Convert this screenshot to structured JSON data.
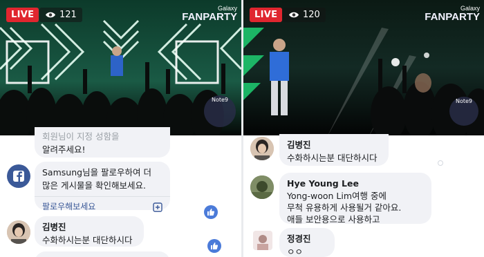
{
  "left": {
    "live_label": "LIVE",
    "viewer_count": "121",
    "logo_line1": "Galaxy",
    "logo_line2": "FANPARTY",
    "badge_text": "Note9",
    "comments": [
      {
        "text_line1": "회원님이 지정 성함을",
        "text_line2": "알려주세요!"
      },
      {
        "text_line1": "Samsung님을 팔로우하여 더",
        "text_line2": "많은 게시물을 확인해보세요.",
        "action": "팔로우해보세요",
        "action_icon": "plus-square-icon"
      },
      {
        "name": "김병진",
        "text": "수화하시는분 대단하시다"
      }
    ]
  },
  "right": {
    "live_label": "LIVE",
    "viewer_count": "120",
    "logo_line1": "Galaxy",
    "logo_line2": "FANPARTY",
    "badge_text": "Note9",
    "comments": [
      {
        "name": "김병진",
        "text": "수화하시는분 대단하시다"
      },
      {
        "name": "Hye Young Lee",
        "line1": "Yong-woon Lim여행 중에",
        "line2": "무척 유용하게 사용될거 같아요.",
        "line3": "애들 보안용으로 사용하고"
      },
      {
        "name": "정경진",
        "text": "ㅇㅇ"
      }
    ]
  },
  "colors": {
    "live_red": "#e0262f",
    "facebook_blue": "#3b5998",
    "bubble_gray": "#f1f2f6"
  }
}
